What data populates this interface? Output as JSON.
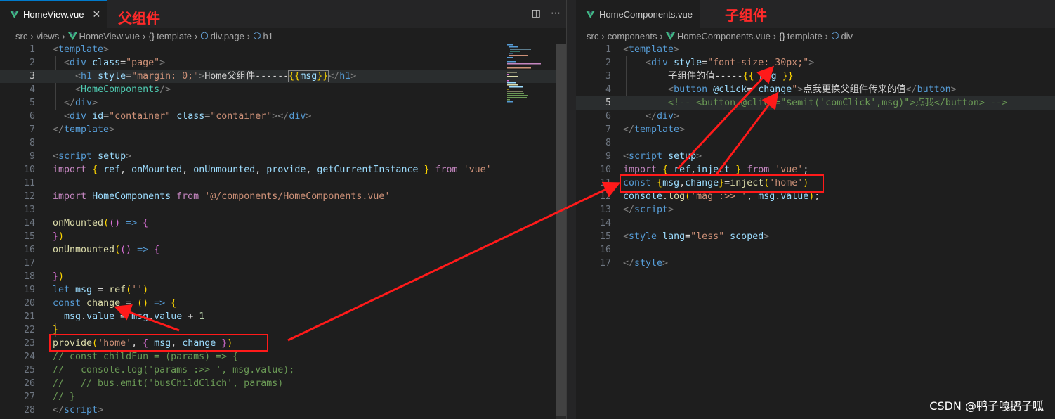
{
  "left_editor": {
    "tab_label": "HomeView.vue",
    "tab_close": "✕",
    "annotation": "父组件",
    "breadcrumb": [
      "src",
      "views",
      "HomeView.vue",
      "template",
      "div.page",
      "h1"
    ],
    "current_line": 3
  },
  "right_editor": {
    "tab_label": "HomeComponents.vue",
    "annotation": "子组件",
    "breadcrumb": [
      "src",
      "components",
      "HomeComponents.vue",
      "template",
      "div"
    ],
    "current_line": 5
  },
  "watermark": "CSDN @鸭子嘎鹅子呱",
  "colors": {
    "annotation": "#ff2a2a",
    "highlight_box": "#ff1a1a",
    "vue_logo": "#41b883"
  }
}
